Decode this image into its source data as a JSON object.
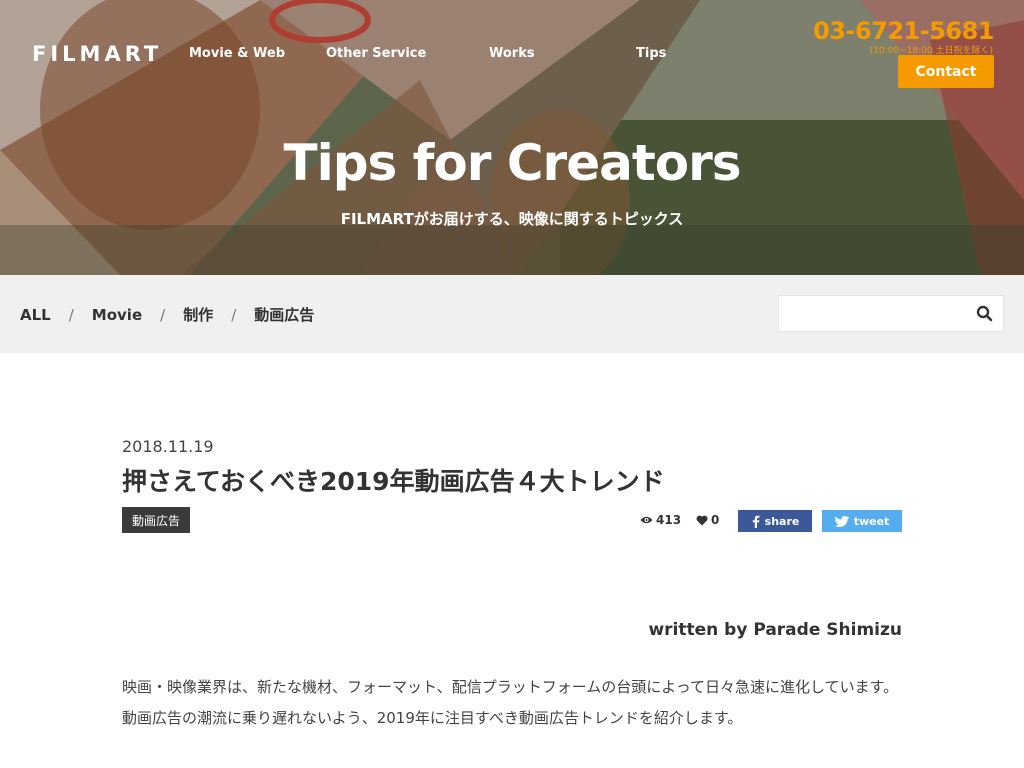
{
  "header": {
    "brand": "FILMART",
    "nav": [
      "Movie & Web",
      "Other Service",
      "Works",
      "Tips"
    ],
    "phone": "03-6721-5681",
    "hours": "(10:00~18:00 土日祝を除く)",
    "contact_label": "Contact"
  },
  "hero": {
    "title": "Tips for Creators",
    "subtitle": "FILMARTがお届けする、映像に関するトピックス"
  },
  "breadcrumb": {
    "items": [
      "ALL",
      "Movie",
      "制作",
      "動画広告"
    ],
    "separator": "/"
  },
  "search": {
    "placeholder": ""
  },
  "article": {
    "date": "2018.11.19",
    "title": "押さえておくべき2019年動画広告４大トレンド",
    "tag": "動画広告",
    "views": "413",
    "likes": "0",
    "share_label": "share",
    "tweet_label": "tweet",
    "author": "written by Parade Shimizu",
    "body": "映画・映像業界は、新たな機材、フォーマット、配信プラットフォームの台頭によって日々急速に進化しています。動画広告の潮流に乗り遅れないよう、2019年に注目すべき動画広告トレンドを紹介します。"
  },
  "colors": {
    "accent": "#f59b00",
    "facebook": "#3b5998",
    "twitter": "#55acee",
    "filterbar": "#f0f0f0",
    "tag_bg": "#3a3a3a"
  }
}
